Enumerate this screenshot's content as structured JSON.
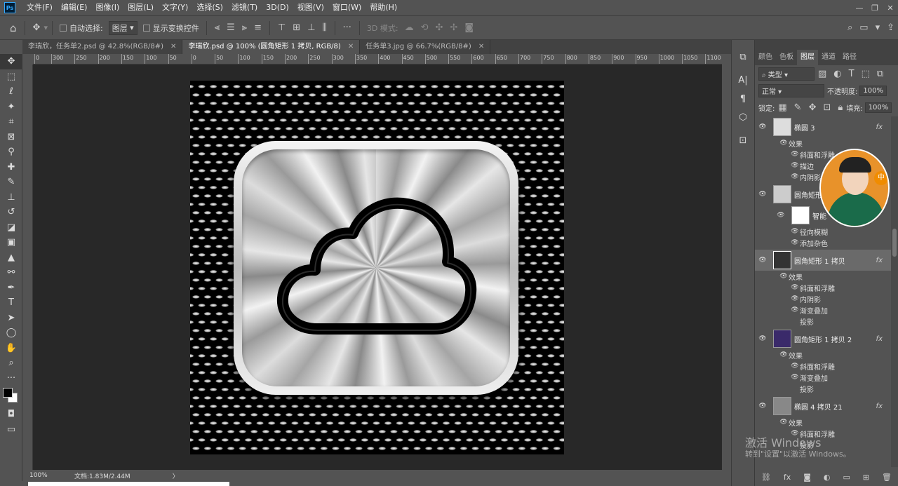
{
  "app": {
    "logo": "Ps"
  },
  "menu": [
    "文件(F)",
    "编辑(E)",
    "图像(I)",
    "图层(L)",
    "文字(Y)",
    "选择(S)",
    "滤镜(T)",
    "3D(D)",
    "视图(V)",
    "窗口(W)",
    "帮助(H)"
  ],
  "window_controls": {
    "min": "—",
    "restore": "❐",
    "close": "✕"
  },
  "options": {
    "auto_select_label": "自动选择:",
    "auto_select_value": "图层",
    "show_transform_label": "显示变换控件",
    "mode_3d_label": "3D 模式:",
    "more": "···"
  },
  "tabs": [
    {
      "label": "李瑞欣，任务单2.psd @ 42.8%(RGB/8#)",
      "close": "✕",
      "active": false
    },
    {
      "label": "李瑞欣.psd @ 100% (圆角矩形 1 拷贝, RGB/8)",
      "close": "✕",
      "active": true
    },
    {
      "label": "任务单3.jpg @ 66.7%(RGB/8#)",
      "close": "✕",
      "active": false
    }
  ],
  "ruler_top": [
    "300",
    "250",
    "200",
    "150",
    "100",
    "50",
    "0",
    "50",
    "100",
    "150",
    "200",
    "250",
    "300",
    "350",
    "400",
    "450",
    "500",
    "550",
    "600",
    "650",
    "700",
    "750",
    "800",
    "850",
    "900",
    "950",
    "1000",
    "1050",
    "1100"
  ],
  "ruler_top_first": "0",
  "status": {
    "zoom": "100%",
    "doc": "文档:1.83M/2.44M",
    "arrow": "〉"
  },
  "panel_tabs": [
    "颜色",
    "色板",
    "图层",
    "通道",
    "路径"
  ],
  "layers_panel": {
    "filter_label": "类型",
    "blend_mode": "正常",
    "opacity_label": "不透明度:",
    "opacity_value": "100%",
    "lock_label": "锁定:",
    "fill_label": "填充:",
    "fill_value": "100%"
  },
  "layers": [
    {
      "name": "椭圆 3",
      "fx": "fx",
      "effects_label": "效果",
      "effects": [
        "斜面和浮雕",
        "描边",
        "内阴影"
      ]
    },
    {
      "name": "圆角矩形",
      "mask_label": "智能",
      "filters": [
        "径向模糊",
        "添加杂色"
      ]
    },
    {
      "name": "圆角矩形 1 拷贝",
      "fx": "fx",
      "effects_label": "效果",
      "effects": [
        "斜面和浮雕",
        "内阴影",
        "渐变叠加",
        "投影"
      ],
      "selected": true
    },
    {
      "name": "圆角矩形 1 拷贝 2",
      "fx": "fx",
      "effects_label": "效果",
      "effects": [
        "斜面和浮雕",
        "渐变叠加",
        "投影"
      ]
    },
    {
      "name": "椭圆 4 拷贝 21",
      "fx": "fx",
      "effects_label": "效果",
      "effects": [
        "斜面和浮雕",
        "投影"
      ]
    }
  ],
  "avatar_badge": "中",
  "watermark": {
    "line1": "激活 Windows",
    "line2": "转到\"设置\"以激活 Windows。"
  },
  "colors": {
    "canvas_bg": "#282828",
    "panel_bg": "#535353",
    "doc_bg": "#000000",
    "foreground": "#000000",
    "background": "#ffffff"
  }
}
